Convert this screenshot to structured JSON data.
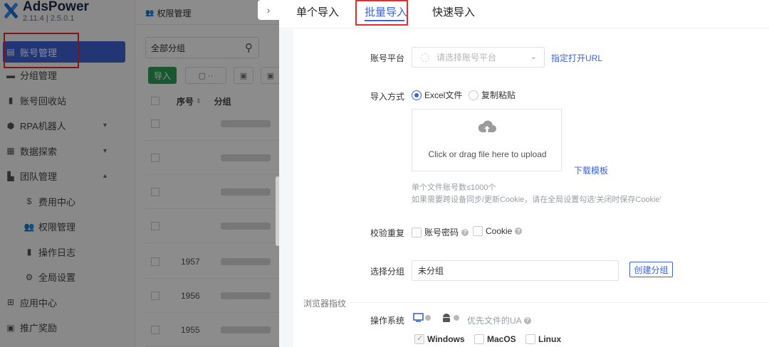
{
  "app": {
    "name": "AdsPower",
    "version": "2.11.4 | 2.5.0.1"
  },
  "sidebar": {
    "items": [
      {
        "label": "账号管理",
        "icon": "list-icon"
      },
      {
        "label": "分组管理",
        "icon": "folder-icon"
      },
      {
        "label": "账号回收站",
        "icon": "trash-icon"
      },
      {
        "label": "RPA机器人",
        "icon": "robot-icon"
      },
      {
        "label": "数据探索",
        "icon": "chart-icon"
      },
      {
        "label": "团队管理",
        "icon": "team-icon"
      },
      {
        "label": "费用中心",
        "icon": "dollar-icon"
      },
      {
        "label": "权限管理",
        "icon": "users-icon"
      },
      {
        "label": "操作日志",
        "icon": "file-icon"
      },
      {
        "label": "全局设置",
        "icon": "gear-icon"
      },
      {
        "label": "应用中心",
        "icon": "grid-icon"
      },
      {
        "label": "推广奖励",
        "icon": "gift-icon"
      }
    ]
  },
  "list_panel": {
    "tab_title": "权限管理",
    "search_value": "全部分组",
    "import_label": "导入",
    "columns": [
      "序号",
      "分组"
    ],
    "row_numbers": [
      "1957",
      "1956",
      "1955"
    ]
  },
  "drawer": {
    "tabs": [
      "单个导入",
      "批量导入",
      "快速导入"
    ],
    "active_tab": "批量导入",
    "platform": {
      "label": "账号平台",
      "placeholder": "请选择账号平台",
      "link": "指定打开URL"
    },
    "import_method": {
      "label": "导入方式",
      "options": [
        "Excel文件",
        "复制粘贴"
      ],
      "selected": "Excel文件"
    },
    "upload": {
      "text": "Click or drag file here to upload",
      "template_link": "下载模板",
      "hint1": "单个文件账号数≤1000个",
      "hint2": "如果需要跨设备同步/更新Cookie，请在全局设置勾选'关闭时保存Cookie'"
    },
    "dedupe": {
      "label": "校验重复",
      "options": [
        "账号密码",
        "Cookie"
      ]
    },
    "group": {
      "label": "选择分组",
      "value": "未分组",
      "create_label": "创建分组"
    },
    "fingerprint": {
      "section_title": "浏览器指纹",
      "os_label": "操作系统",
      "ua_hint": "优先文件的UA",
      "os_options": [
        "Windows",
        "MacOS",
        "Linux"
      ],
      "selected_os": "Windows"
    }
  },
  "colors": {
    "accent": "#3f63d8",
    "highlight": "#e52d2d",
    "import_green": "#2f9e5a"
  }
}
